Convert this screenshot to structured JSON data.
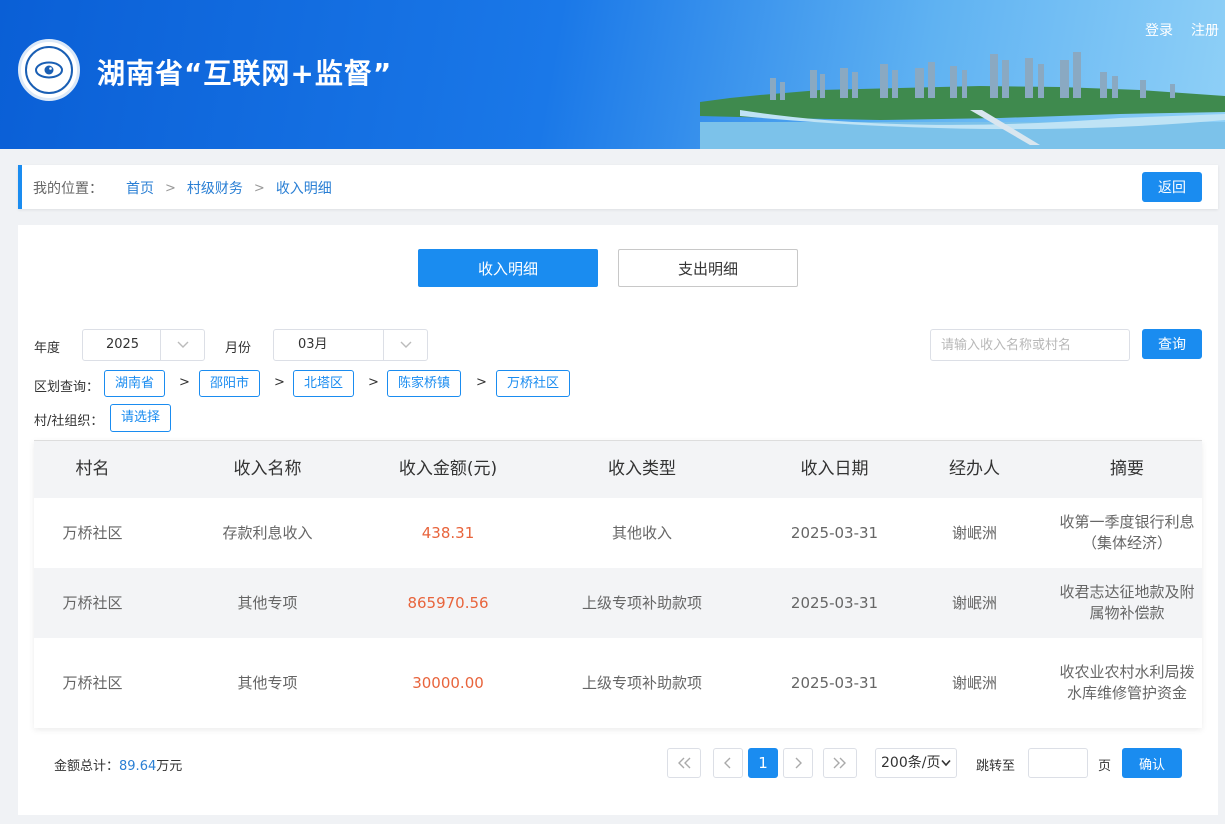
{
  "header": {
    "title": "湖南省“互联网+监督”",
    "login": "登录",
    "register": "注册"
  },
  "breadcrumb": {
    "label": "我的位置：",
    "items": [
      "首页",
      "村级财务",
      "收入明细"
    ],
    "separator": ">",
    "back": "返回"
  },
  "tabs": {
    "income": "收入明细",
    "expense": "支出明细"
  },
  "filters": {
    "year_label": "年度",
    "year_value": "2025",
    "month_label": "月份",
    "month_value": "03月",
    "search_placeholder": "请输入收入名称或村名",
    "search_button": "查询",
    "region_label": "区划查询：",
    "regions": [
      "湖南省",
      "邵阳市",
      "北塔区",
      "陈家桥镇",
      "万桥社区"
    ],
    "org_label": "村/社组织：",
    "org_value": "请选择"
  },
  "table": {
    "headers": [
      "村名",
      "收入名称",
      "收入金额(元)",
      "收入类型",
      "收入日期",
      "经办人",
      "摘要"
    ],
    "rows": [
      [
        "万桥社区",
        "存款利息收入",
        "438.31",
        "其他收入",
        "2025-03-31",
        "谢岷洲",
        "收第一季度银行利息（集体经济）"
      ],
      [
        "万桥社区",
        "其他专项",
        "865970.56",
        "上级专项补助款项",
        "2025-03-31",
        "谢岷洲",
        "收君志达征地款及附属物补偿款"
      ],
      [
        "万桥社区",
        "其他专项",
        "30000.00",
        "上级专项补助款项",
        "2025-03-31",
        "谢岷洲",
        "收农业农村水利局拨水库维修管护资金"
      ]
    ]
  },
  "footer": {
    "total_label": "金额总计：",
    "total_value": "89.64",
    "total_unit": "万元",
    "current_page": "1",
    "per_page": "200条/页",
    "jump_label": "跳转至",
    "page_unit": "页",
    "confirm": "确认"
  },
  "colors": {
    "accent": "#1a8cf0",
    "amount": "#e8643c",
    "link": "#2a7fd4"
  },
  "icons": [
    "logo-emblem-icon",
    "chevron-down-icon",
    "double-left-icon",
    "left-icon",
    "right-icon",
    "double-right-icon"
  ]
}
